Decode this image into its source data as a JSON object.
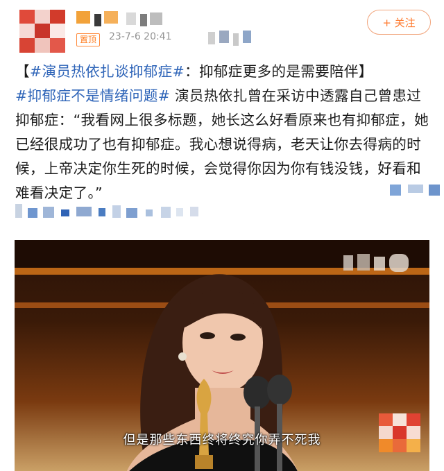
{
  "header": {
    "avatar": "pixelated-avatar",
    "username": "",
    "pin_badge": "置顶",
    "timestamp": "23-7-6 20:41",
    "follow_label": "+ 关注"
  },
  "post": {
    "bracket_open": "【",
    "title_tag": "#演员热依扎谈抑郁症#",
    "title_rest": "：抑郁症更多的是需要陪伴】",
    "tag2": "#抑郁症不是情绪问题#",
    "body": " 演员热依扎曾在采访中透露自己曾患过抑郁症：“我看网上很多标题，她长这么好看原来也有抑郁症，她已经很成功了也有抑郁症。我心想说得病，老天让你去得病的时候，上帝决定你生死的时候，会觉得你因为你有钱没钱，好看和难看决定了。”"
  },
  "media": {
    "subtitle": "但是那些东西终将终究你弄不死我"
  },
  "colors": {
    "accent": "#ff7a2e",
    "link": "#2e64b8",
    "muted": "#939393"
  }
}
